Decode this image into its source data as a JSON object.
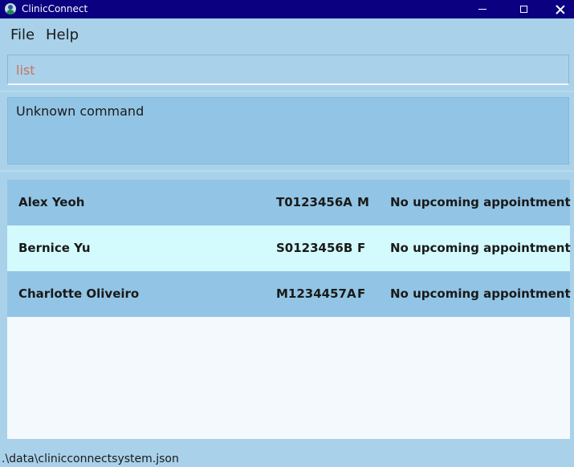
{
  "window": {
    "title": "ClinicConnect"
  },
  "menu": [
    {
      "label": "File"
    },
    {
      "label": "Help"
    }
  ],
  "command_box": {
    "value": "list"
  },
  "result": {
    "message": "Unknown command"
  },
  "patients": [
    {
      "name": "Alex Yeoh",
      "nric": "T0123456A",
      "sex": "M",
      "appointment": "No upcoming appointment",
      "row_color": "#92c5e5"
    },
    {
      "name": "Bernice Yu",
      "nric": "S0123456B",
      "sex": "F",
      "appointment": "No upcoming appointment",
      "row_color": "#d3fafc"
    },
    {
      "name": "Charlotte Oliveiro",
      "nric": "M1234457A",
      "sex": "F",
      "appointment": "No upcoming appointment",
      "row_color": "#92c5e5"
    }
  ],
  "status_bar": {
    "path": ".\\data\\clinicconnectsystem.json"
  },
  "icons": {
    "app": "clinicconnect-app-icon",
    "minimize": "minimize-icon",
    "maximize": "maximize-icon",
    "close": "close-icon"
  },
  "colors": {
    "titlebar": "#0a0080",
    "background": "#a9d1ea",
    "command_text": "#c8745a",
    "list_background": "#f4f9fd"
  }
}
